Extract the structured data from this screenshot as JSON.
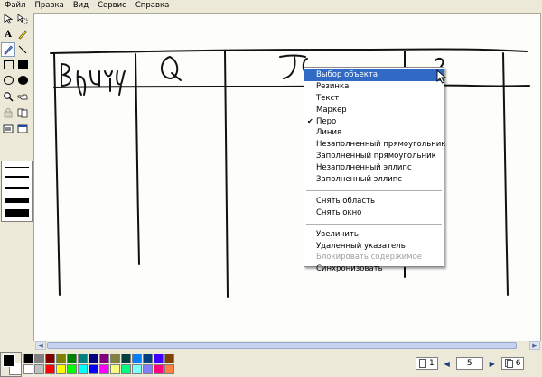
{
  "menubar": [
    "Файл",
    "Правка",
    "Вид",
    "Сервис",
    "Справка"
  ],
  "tools": [
    {
      "name": "free-select-tool",
      "glyph": "⬚"
    },
    {
      "name": "select-tool",
      "glyph": "⬚"
    },
    {
      "name": "text-tool",
      "glyph": "A"
    },
    {
      "name": "highlighter-tool",
      "glyph": "✎"
    },
    {
      "name": "pen-tool",
      "glyph": "✎",
      "active": true
    },
    {
      "name": "line-tool",
      "glyph": "╲"
    },
    {
      "name": "rectangle-tool"
    },
    {
      "name": "filled-rectangle-tool"
    },
    {
      "name": "ellipse-tool"
    },
    {
      "name": "filled-ellipse-tool"
    },
    {
      "name": "zoom-tool",
      "glyph": "🔍"
    },
    {
      "name": "remote-pointer-tool",
      "glyph": "☞"
    },
    {
      "name": "lock-tool",
      "glyph": "🔒"
    },
    {
      "name": "sync-tool",
      "glyph": "⟳"
    },
    {
      "name": "area-capture-tool",
      "glyph": "▣"
    },
    {
      "name": "window-capture-tool",
      "glyph": "▣"
    }
  ],
  "canvas": {
    "handwriting": {
      "cell1": "Вид ye",
      "cell2": "Q",
      "cell3": "JC",
      "cell4": "?"
    }
  },
  "context_menu": {
    "groups": [
      [
        {
          "label": "Выбор объекта",
          "highlighted": true
        },
        {
          "label": "Резинка"
        },
        {
          "label": "Текст"
        },
        {
          "label": "Маркер"
        },
        {
          "label": "Перо",
          "checked": true
        },
        {
          "label": "Линия"
        },
        {
          "label": "Незаполненный прямоугольник"
        },
        {
          "label": "Заполненный прямоугольник"
        },
        {
          "label": "Незаполненный эллипс"
        },
        {
          "label": "Заполненный эллипс"
        }
      ],
      [
        {
          "label": "Снять область"
        },
        {
          "label": "Снять окно"
        }
      ],
      [
        {
          "label": "Увеличить"
        },
        {
          "label": "Удаленный указатель"
        },
        {
          "label": "Блокировать содержимое",
          "disabled": true
        },
        {
          "label": "Синхронизовать"
        }
      ]
    ]
  },
  "palette": {
    "colors": [
      "#000000",
      "#808080",
      "#800000",
      "#808000",
      "#008000",
      "#008080",
      "#000080",
      "#800080",
      "#808040",
      "#004040",
      "#0080ff",
      "#004080",
      "#4000ff",
      "#804000",
      "#ffffff",
      "#c0c0c0",
      "#ff0000",
      "#ffff00",
      "#00ff00",
      "#00ffff",
      "#0000ff",
      "#ff00ff",
      "#ffff80",
      "#00ff80",
      "#80ffff",
      "#8080ff",
      "#ff0080",
      "#ff8040"
    ]
  },
  "status": {
    "page_label": "1",
    "current_page": "5",
    "total_pages": "6"
  }
}
